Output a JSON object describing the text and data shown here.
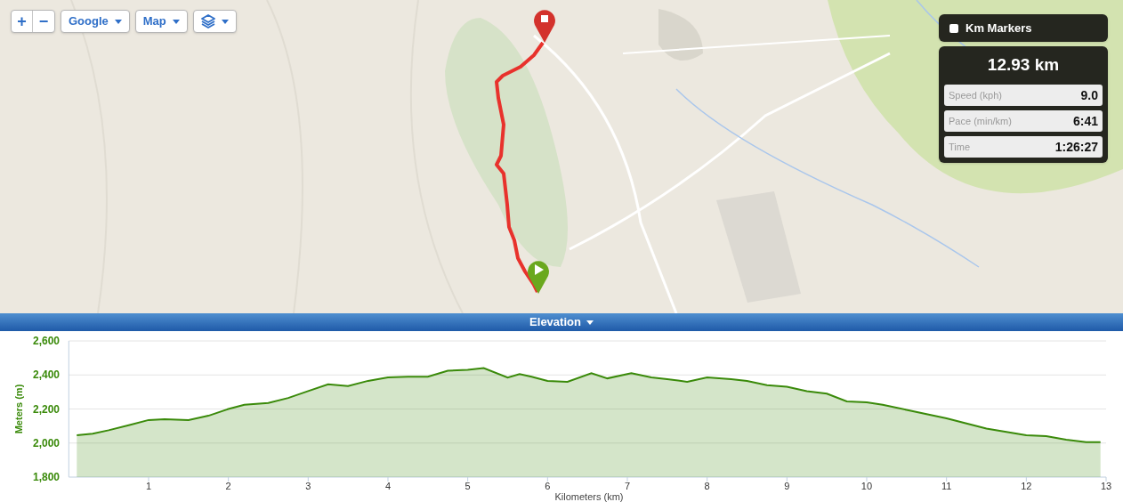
{
  "map_controls": {
    "zoom_in": "+",
    "zoom_out": "−",
    "buttons": [
      {
        "label": "Google",
        "kind": "text"
      },
      {
        "label": "Map",
        "kind": "text"
      },
      {
        "kind": "layers"
      }
    ]
  },
  "km_markers": {
    "label": "Km Markers",
    "checked": false
  },
  "stats": {
    "distance": "12.93 km",
    "rows": [
      {
        "label": "Speed (kph)",
        "value": "9.0"
      },
      {
        "label": "Pace (min/km)",
        "value": "6:41"
      },
      {
        "label": "Time",
        "value": "1:26:27"
      }
    ]
  },
  "elevation_bar": {
    "title": "Elevation"
  },
  "chart": {
    "chart_data": {
      "type": "area",
      "grid": true,
      "xlabel": "Kilometers (km)",
      "ylabel": "Meters (m)",
      "xlim": [
        0,
        13
      ],
      "ylim": [
        1800,
        2600
      ],
      "xticks": [
        1,
        2,
        3,
        4,
        5,
        6,
        7,
        8,
        9,
        10,
        11,
        12,
        13
      ],
      "yticks": [
        {
          "value": 1800,
          "label": "1,800"
        },
        {
          "value": 2000,
          "label": "2,000"
        },
        {
          "value": 2200,
          "label": "2,200"
        },
        {
          "value": 2400,
          "label": "2,400"
        },
        {
          "value": 2600,
          "label": "2,600"
        }
      ],
      "x": [
        0.1,
        0.3,
        0.5,
        0.75,
        1.0,
        1.2,
        1.5,
        1.75,
        2.0,
        2.2,
        2.5,
        2.75,
        3.0,
        3.25,
        3.5,
        3.75,
        4.0,
        4.25,
        4.5,
        4.75,
        5.0,
        5.2,
        5.5,
        5.65,
        5.8,
        6.0,
        6.25,
        6.55,
        6.75,
        7.05,
        7.3,
        7.5,
        7.75,
        8.0,
        8.3,
        8.5,
        8.75,
        9.0,
        9.25,
        9.5,
        9.75,
        10.0,
        10.2,
        10.5,
        10.75,
        11.0,
        11.25,
        11.5,
        11.75,
        12.0,
        12.25,
        12.5,
        12.75,
        12.93
      ],
      "series": [
        {
          "color": "#3a8a0a",
          "values": [
            2045,
            2055,
            2075,
            2105,
            2135,
            2140,
            2135,
            2160,
            2200,
            2225,
            2235,
            2265,
            2305,
            2345,
            2335,
            2365,
            2385,
            2390,
            2390,
            2425,
            2430,
            2440,
            2385,
            2405,
            2390,
            2365,
            2360,
            2410,
            2380,
            2410,
            2385,
            2375,
            2360,
            2385,
            2375,
            2365,
            2340,
            2330,
            2305,
            2290,
            2245,
            2240,
            2225,
            2195,
            2170,
            2145,
            2115,
            2085,
            2065,
            2045,
            2040,
            2020,
            2005,
            2005
          ]
        }
      ]
    }
  }
}
